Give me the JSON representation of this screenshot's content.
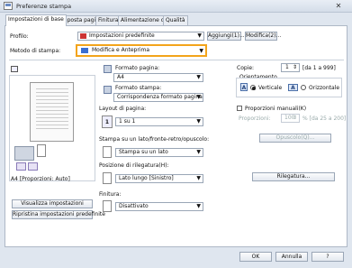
{
  "window": {
    "title": "Preferenze stampa",
    "close_label": "✕"
  },
  "tabs": [
    "Impostazioni di base",
    "Imposta pagina",
    "Finitura",
    "Alimentazione carta",
    "Qualità"
  ],
  "profile": {
    "label": "Profilo:",
    "value": "Impostazioni predefinite",
    "add_label": "Aggiungi(1)...",
    "edit_label": "Modifica(2)..."
  },
  "method": {
    "label": "Metodo di stampa:",
    "value": "Modifica e Anteprima"
  },
  "preview": {
    "caption": "A4 [Proporzioni: Auto]",
    "view_settings": "Visualizza impostazioni",
    "restore_defaults": "Ripristina impostazioni predefinite"
  },
  "paper": {
    "format_label": "Formato pagina:",
    "format_value": "A4",
    "output_label": "Formato stampa:",
    "output_value": "Corrispondenza formato pagina",
    "layout_label": "Layout di pagina:",
    "layout_value": "1 su 1",
    "duplex_label": "Stampa su un lato/fronte-retro/opuscolo:",
    "duplex_value": "Stampa su un lato",
    "binding_label": "Posizione di rilegatura(H):",
    "binding_value": "Lato lungo [Sinistro]",
    "finish_label": "Finitura:",
    "finish_value": "Disattivato"
  },
  "copies": {
    "label": "Copie:",
    "value": "1",
    "range": "[da 1 a 999]"
  },
  "orientation": {
    "label": "Orientamento",
    "vertical": "Verticale",
    "horizontal": "Orizzontale",
    "selected": "vertical"
  },
  "manual_scale": {
    "label": "Proporzioni manuali(K)",
    "ratio_label": "Proporzioni:",
    "ratio_value": "100",
    "ratio_range": "% [da 25 a 200]"
  },
  "booklet_button": "Opuscolo(Q)...",
  "binding_button": "Rilegatura...",
  "footer": {
    "ok": "OK",
    "cancel": "Annulla",
    "help": "?"
  }
}
